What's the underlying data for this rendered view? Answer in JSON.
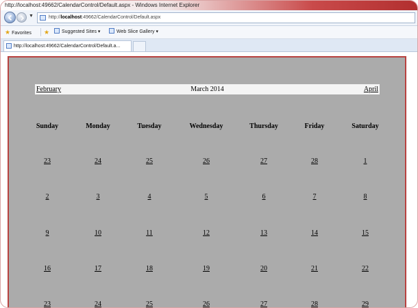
{
  "window": {
    "title": "http://localhost:49662/CalendarControl/Default.aspx - Windows Internet Explorer"
  },
  "address": {
    "prefix": "http://",
    "host": "localhost",
    "path": ":49662/CalendarControl/Default.aspx"
  },
  "favorites": {
    "favorites_label": "Favorites",
    "suggested_label": "Suggested Sites ▾",
    "webslice_label": "Web Slice Gallery ▾"
  },
  "tab": {
    "label": "http://localhost:49662/CalendarControl/Default.a..."
  },
  "calendar": {
    "prev_label": "February",
    "month_label": "March 2014",
    "next_label": "April",
    "weekdays": [
      "Sunday",
      "Monday",
      "Tuesday",
      "Wednesday",
      "Thursday",
      "Friday",
      "Saturday"
    ],
    "weeks": [
      [
        "23",
        "24",
        "25",
        "26",
        "27",
        "28",
        "1"
      ],
      [
        "2",
        "3",
        "4",
        "5",
        "6",
        "7",
        "8"
      ],
      [
        "9",
        "10",
        "11",
        "12",
        "13",
        "14",
        "15"
      ],
      [
        "16",
        "17",
        "18",
        "19",
        "20",
        "21",
        "22"
      ],
      [
        "23",
        "24",
        "25",
        "26",
        "27",
        "28",
        "29"
      ]
    ]
  },
  "colors": {
    "calendar_bg": "#ababab",
    "calendar_border": "#b8413f",
    "title_bg": "#f4f4f4"
  }
}
